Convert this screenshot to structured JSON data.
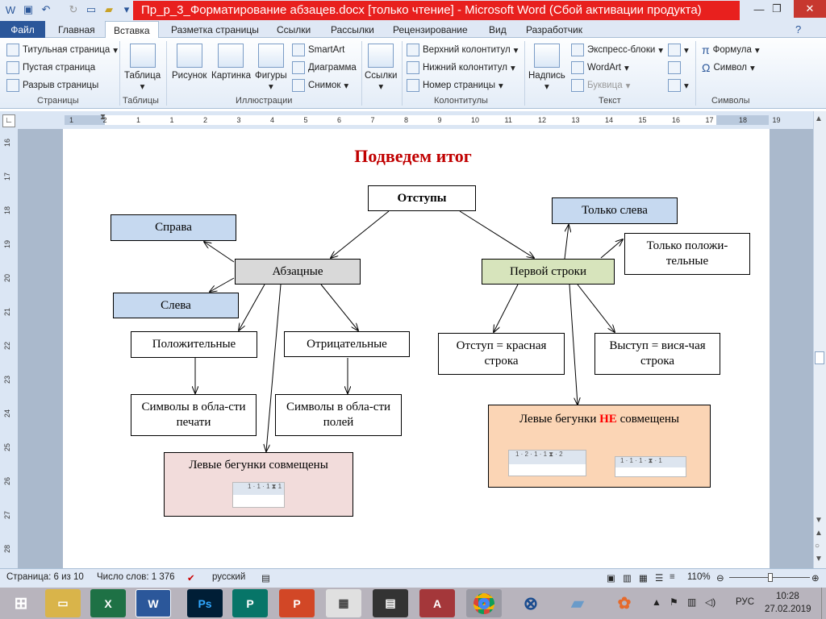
{
  "window": {
    "title": "Пр_р_3_Форматирование абзацев.docx [только чтение]  -  Microsoft Word (Сбой активации продукта)"
  },
  "tabs": [
    "Файл",
    "Главная",
    "Вставка",
    "Разметка страницы",
    "Ссылки",
    "Рассылки",
    "Рецензирование",
    "Вид",
    "Разработчик"
  ],
  "ribbon": {
    "pages": {
      "label": "Страницы",
      "cover": "Титульная страница",
      "blank": "Пустая страница",
      "break": "Разрыв страницы"
    },
    "tables": {
      "label": "Таблицы",
      "table": "Таблица"
    },
    "illustrations": {
      "label": "Иллюстрации",
      "picture": "Рисунок",
      "clipart": "Картинка",
      "shapes": "Фигуры",
      "smartart": "SmartArt",
      "chart": "Диаграмма",
      "screenshot": "Снимок"
    },
    "links": {
      "label": "",
      "links": "Ссылки"
    },
    "headerfooter": {
      "label": "Колонтитулы",
      "header": "Верхний колонтитул",
      "footer": "Нижний колонтитул",
      "pagenum": "Номер страницы"
    },
    "text": {
      "label": "Текст",
      "textbox": "Надпись",
      "quickparts": "Экспресс-блоки",
      "wordart": "WordArt",
      "dropcap": "Буквица"
    },
    "symbols": {
      "label": "Символы",
      "equation": "Формула",
      "symbol": "Символ"
    }
  },
  "ruler": {
    "h_numbers": [
      "1",
      "2",
      "1",
      "1",
      "2",
      "3",
      "4",
      "5",
      "6",
      "7",
      "8",
      "9",
      "10",
      "11",
      "12",
      "13",
      "14",
      "15",
      "16",
      "17",
      "18",
      "19"
    ],
    "v_numbers": [
      "16",
      "17",
      "18",
      "19",
      "20",
      "21",
      "22",
      "23",
      "24",
      "25",
      "26",
      "27",
      "28"
    ]
  },
  "diagram": {
    "title": "Подведем итог",
    "nodes": {
      "root": "Отступы",
      "paragraph": "Абзацные",
      "firstline": "Первой строки",
      "right": "Справа",
      "left": "Слева",
      "positive": "Положительные",
      "negative": "Отрицательные",
      "print_area": "Символы в обла-сти печати",
      "margins_area": "Символы в обла-сти полей",
      "merged": "Левые бегунки совмещены",
      "only_left": "Только слева",
      "only_positive": "Только положи-тельные",
      "red_line": "Отступ = красная строка",
      "hanging": "Выступ = вися-чая строка",
      "not_merged_a": "Левые бегунки ",
      "not_merged_b": "НЕ",
      "not_merged_c": " совмещены"
    }
  },
  "status": {
    "page": "Страница: 6 из 10",
    "words": "Число слов: 1 376",
    "lang": "русский",
    "zoom": "110%"
  },
  "taskbar": {
    "lang": "РУС",
    "time": "10:28",
    "date": "27.02.2019"
  },
  "colors": {
    "accent": "#2b579a",
    "title_red": "#c00000",
    "blue_box": "#c6d9f0",
    "grey_box": "#d9d9d9",
    "green_box": "#d7e4bc",
    "pink_box": "#f2dcdb",
    "peach_box": "#fbd5b5"
  }
}
